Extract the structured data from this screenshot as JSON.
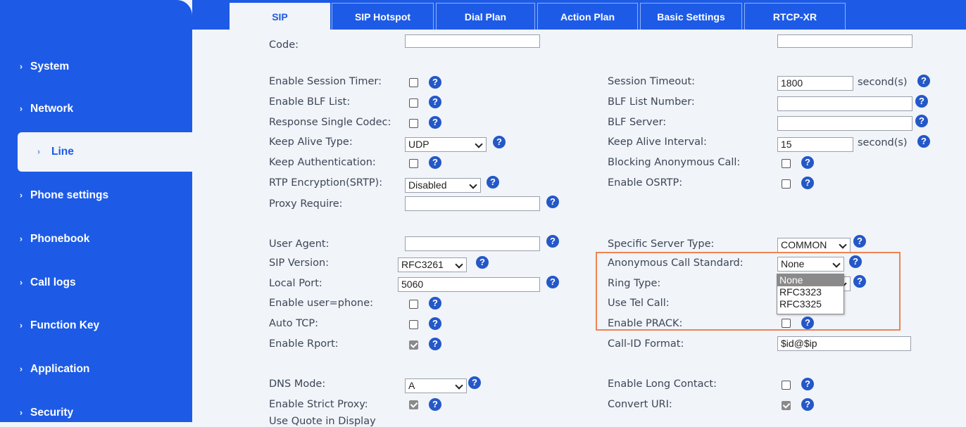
{
  "tabs": [
    {
      "label": "SIP",
      "active": true
    },
    {
      "label": "SIP Hotspot"
    },
    {
      "label": "Dial Plan"
    },
    {
      "label": "Action Plan"
    },
    {
      "label": "Basic Settings"
    },
    {
      "label": "RTCP-XR"
    }
  ],
  "sidebar": {
    "items": [
      {
        "label": "System"
      },
      {
        "label": "Network"
      },
      {
        "label": "Line",
        "active": true
      },
      {
        "label": "Phone settings"
      },
      {
        "label": "Phonebook"
      },
      {
        "label": "Call logs"
      },
      {
        "label": "Function Key"
      },
      {
        "label": "Application"
      },
      {
        "label": "Security"
      }
    ]
  },
  "partial_top_label": "Code:",
  "partial_bottom_label": "Use Quote in Display",
  "help_glyph": "?",
  "chevron_glyph": "›",
  "left_fields": {
    "session_timer": {
      "label": "Enable Session Timer:",
      "checked": false
    },
    "blf_list": {
      "label": "Enable BLF List:",
      "checked": false
    },
    "single_codec": {
      "label": "Response Single Codec:",
      "checked": false
    },
    "keep_alive_type": {
      "label": "Keep Alive Type:",
      "value": "UDP"
    },
    "keep_auth": {
      "label": "Keep Authentication:",
      "checked": false
    },
    "rtp_encryption": {
      "label": "RTP Encryption(SRTP):",
      "value": "Disabled"
    },
    "proxy_require": {
      "label": "Proxy Require:",
      "value": ""
    },
    "user_agent": {
      "label": "User Agent:",
      "value": ""
    },
    "sip_version": {
      "label": "SIP Version:",
      "value": "RFC3261"
    },
    "local_port": {
      "label": "Local Port:",
      "value": "5060"
    },
    "user_phone": {
      "label": "Enable user=phone:",
      "checked": false
    },
    "auto_tcp": {
      "label": "Auto TCP:",
      "checked": false
    },
    "rport": {
      "label": "Enable Rport:",
      "checked": true
    },
    "dns_mode": {
      "label": "DNS Mode:",
      "value": "A"
    },
    "strict_proxy": {
      "label": "Enable Strict Proxy:",
      "checked": true
    }
  },
  "right_fields": {
    "session_timeout": {
      "label": "Session Timeout:",
      "value": "1800",
      "unit": "second(s)"
    },
    "blf_list_number": {
      "label": "BLF List Number:",
      "value": ""
    },
    "blf_server": {
      "label": "BLF Server:",
      "value": ""
    },
    "keep_alive_interval": {
      "label": "Keep Alive Interval:",
      "value": "15",
      "unit": "second(s)"
    },
    "blocking_anon": {
      "label": "Blocking Anonymous Call:",
      "checked": false
    },
    "osrtp": {
      "label": "Enable OSRTP:",
      "checked": false
    },
    "server_type": {
      "label": "Specific Server Type:",
      "value": "COMMON"
    },
    "anon_standard": {
      "label": "Anonymous Call Standard:",
      "value": "None"
    },
    "ring_type": {
      "label": "Ring Type:"
    },
    "use_tel_call": {
      "label": "Use Tel Call:"
    },
    "prack": {
      "label": "Enable PRACK:",
      "checked": false
    },
    "callid_format": {
      "label": "Call-ID Format:",
      "value": "$id@$ip"
    },
    "long_contact": {
      "label": "Enable Long Contact:",
      "checked": false
    },
    "convert_uri": {
      "label": "Convert URI:",
      "checked": true
    }
  },
  "dropdown_options": [
    "None",
    "RFC3323",
    "RFC3325"
  ],
  "colors": {
    "accent": "#1d5be6",
    "highlight": "#ef8450",
    "help": "#2458c8",
    "background": "#f1f4f9"
  }
}
